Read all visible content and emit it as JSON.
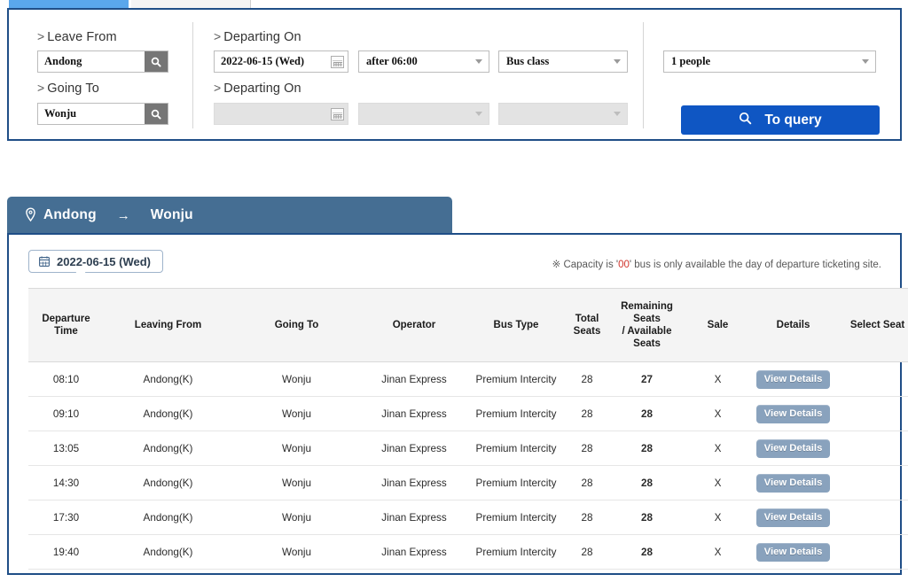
{
  "tabs": [
    {
      "label": "",
      "active": true
    },
    {
      "label": "",
      "active": false
    }
  ],
  "search": {
    "leave_from": {
      "label": "Leave From",
      "value": "Andong",
      "icon": "search-icon"
    },
    "going_to": {
      "label": "Going To",
      "value": "Wonju",
      "icon": "search-icon"
    },
    "departing_on_1": {
      "label": "Departing On",
      "date": "2022-06-15 (Wed)",
      "time": "after 06:00",
      "bus_class": "Bus class"
    },
    "departing_on_2": {
      "label": "Departing On",
      "date": "",
      "time": "",
      "bus_class": ""
    },
    "passengers": "1 people",
    "query_button": "To query",
    "query_icon": "search-icon",
    "accent_color": "#0f56c3",
    "panel_border_color": "#1f4e87"
  },
  "route_header": {
    "origin": "Andong",
    "arrow": "→",
    "destination": "Wonju",
    "pin_icon": "location-pin-icon",
    "background_color": "#456e93"
  },
  "results": {
    "date_chip": {
      "label": "2022-06-15 (Wed)",
      "icon": "calendar-icon"
    },
    "notice": {
      "prefix": "※ Capacity is '",
      "highlight": "00",
      "suffix": "' bus is only available the day of departure ticketing site.",
      "highlight_color": "#d0342c"
    },
    "columns": [
      "Departure\nTime",
      "Leaving From",
      "Going To",
      "Operator",
      "Bus Type",
      "Total\nSeats",
      "Remaining\nSeats\n/ Available\nSeats",
      "Sale",
      "Details",
      "Select Seat"
    ],
    "column_labels": {
      "departure_time": "Departure Time",
      "leaving_from": "Leaving From",
      "going_to": "Going To",
      "operator": "Operator",
      "bus_type": "Bus Type",
      "total_seats": "Total Seats",
      "remaining_seats": "Remaining Seats / Available Seats",
      "sale": "Sale",
      "details": "Details",
      "select_seat": "Select Seat"
    },
    "details_button_label": "View Details",
    "rows": [
      {
        "time": "08:10",
        "from": "Andong(K)",
        "to": "Wonju",
        "operator": "Jinan Express",
        "bus_type": "Premium Intercity",
        "total": "28",
        "remaining": "27",
        "sale": "X",
        "details": "View Details",
        "seat": ""
      },
      {
        "time": "09:10",
        "from": "Andong(K)",
        "to": "Wonju",
        "operator": "Jinan Express",
        "bus_type": "Premium Intercity",
        "total": "28",
        "remaining": "28",
        "sale": "X",
        "details": "View Details",
        "seat": ""
      },
      {
        "time": "13:05",
        "from": "Andong(K)",
        "to": "Wonju",
        "operator": "Jinan Express",
        "bus_type": "Premium Intercity",
        "total": "28",
        "remaining": "28",
        "sale": "X",
        "details": "View Details",
        "seat": ""
      },
      {
        "time": "14:30",
        "from": "Andong(K)",
        "to": "Wonju",
        "operator": "Jinan Express",
        "bus_type": "Premium Intercity",
        "total": "28",
        "remaining": "28",
        "sale": "X",
        "details": "View Details",
        "seat": ""
      },
      {
        "time": "17:30",
        "from": "Andong(K)",
        "to": "Wonju",
        "operator": "Jinan Express",
        "bus_type": "Premium Intercity",
        "total": "28",
        "remaining": "28",
        "sale": "X",
        "details": "View Details",
        "seat": ""
      },
      {
        "time": "19:40",
        "from": "Andong(K)",
        "to": "Wonju",
        "operator": "Jinan Express",
        "bus_type": "Premium Intercity",
        "total": "28",
        "remaining": "28",
        "sale": "X",
        "details": "View Details",
        "seat": ""
      }
    ]
  }
}
